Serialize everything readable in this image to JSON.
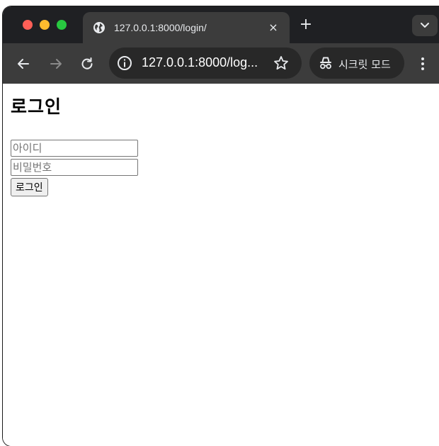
{
  "browser": {
    "tab": {
      "title": "127.0.0.1:8000/login/",
      "close_label": "×",
      "icon": "globe-icon"
    },
    "new_tab_label": "+",
    "omnibox": {
      "url": "127.0.0.1:8000/log...",
      "info_icon": "info-icon",
      "star_icon": "star-icon"
    },
    "incognito": {
      "label": "시크릿 모드",
      "icon": "incognito-icon"
    },
    "colors": {
      "titlebar": "#1f2023",
      "toolbar": "#3c3c3c",
      "omnibox": "#282828",
      "traffic_red": "#ff5f57",
      "traffic_yellow": "#febc2e",
      "traffic_green": "#28c840"
    }
  },
  "page": {
    "title": "로그인",
    "username_placeholder": "아이디",
    "username_value": "",
    "password_placeholder": "비밀번호",
    "password_value": "",
    "submit_label": "로그인"
  }
}
